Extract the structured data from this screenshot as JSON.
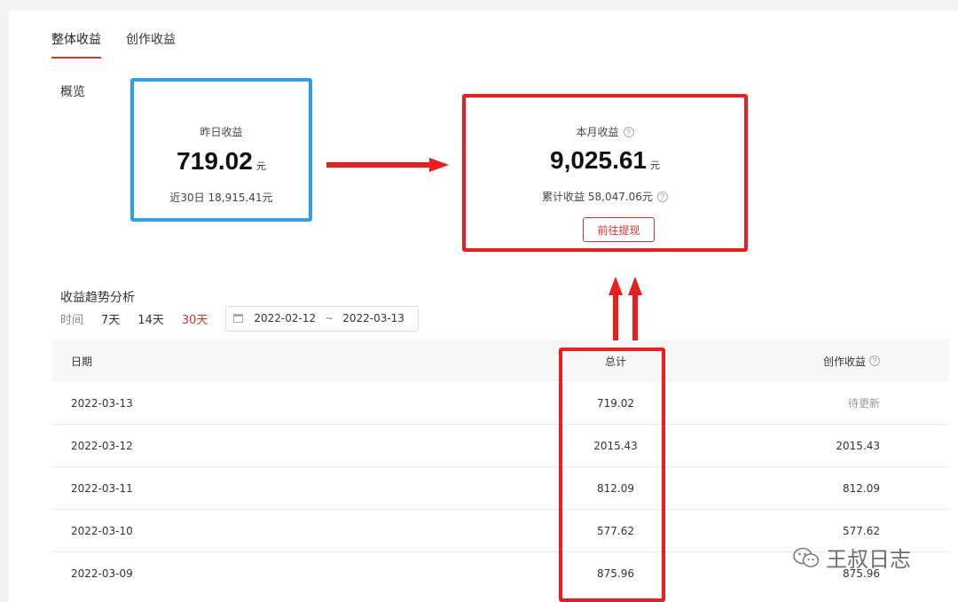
{
  "tabs": [
    {
      "label": "整体收益",
      "active": true
    },
    {
      "label": "创作收益",
      "active": false
    }
  ],
  "overview": {
    "label": "概览",
    "yesterday": {
      "title": "昨日收益",
      "amount": "719.02",
      "unit": "元",
      "sub": "近30日 18,915.41元"
    },
    "month": {
      "title": "本月收益",
      "amount": "9,025.61",
      "unit": "元",
      "sub": "累计收益 58,047.06元",
      "button": "前往提现"
    }
  },
  "trend": {
    "label": "收益趋势分析",
    "filter_label": "时间",
    "options": [
      {
        "label": "7天",
        "active": false
      },
      {
        "label": "14天",
        "active": false
      },
      {
        "label": "30天",
        "active": true
      }
    ],
    "date_start": "2022-02-12",
    "date_sep": "~",
    "date_end": "2022-03-13"
  },
  "table": {
    "headers": {
      "date": "日期",
      "total": "总计",
      "create": "创作收益"
    },
    "rows": [
      {
        "date": "2022-03-13",
        "total": "719.02",
        "create": "待更新"
      },
      {
        "date": "2022-03-12",
        "total": "2015.43",
        "create": "2015.43"
      },
      {
        "date": "2022-03-11",
        "total": "812.09",
        "create": "812.09"
      },
      {
        "date": "2022-03-10",
        "total": "577.62",
        "create": "577.62"
      },
      {
        "date": "2022-03-09",
        "total": "875.96",
        "create": "875.96"
      }
    ]
  },
  "watermark": {
    "text": "王叔日志",
    "icon": "wechat-icon"
  },
  "colors": {
    "accent": "#e22e2e",
    "highlight_blue": "#2f9ef0",
    "highlight_red": "#ee1c1c"
  }
}
